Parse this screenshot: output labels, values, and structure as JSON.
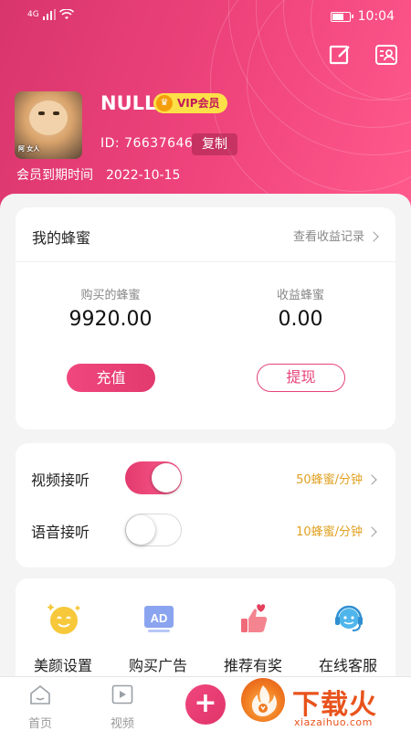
{
  "status_bar": {
    "network": "4G",
    "time": "10:04"
  },
  "profile": {
    "username": "NULL",
    "vip_badge": "VIP会员",
    "uid_text": "ID: 76637646",
    "copy_label": "复制",
    "expire_label": "会员到期时间",
    "expire_date": "2022-10-15",
    "avatar_caption": "阿 女人 "
  },
  "honey": {
    "title": "我的蜂蜜",
    "records_link": "查看收益记录",
    "bought_label": "购买的蜂蜜",
    "bought_value": "9920.00",
    "income_label": "收益蜂蜜",
    "income_value": "0.00",
    "recharge_label": "充值",
    "withdraw_label": "提现"
  },
  "toggles": [
    {
      "label": "视频接听",
      "rate": "50蜂蜜/分钟",
      "on": true
    },
    {
      "label": "语音接听",
      "rate": "10蜂蜜/分钟",
      "on": false
    }
  ],
  "features": [
    {
      "label": "美颜设置",
      "icon": "beauty-smiley-icon"
    },
    {
      "label": "购买广告",
      "icon": "ad-icon"
    },
    {
      "label": "推荐有奖",
      "icon": "thumbs-up-heart-icon"
    },
    {
      "label": "在线客服",
      "icon": "headset-support-icon"
    }
  ],
  "tabbar": {
    "home_label": "首页",
    "video_label": "视频",
    "plus_icon": "plus-icon"
  },
  "watermark": {
    "text": "下载火",
    "url": "xiazaihuo.com"
  },
  "colors": {
    "accent": "#f0447d",
    "rate_text": "#e0a020",
    "vip_yellow": "#fde047"
  }
}
